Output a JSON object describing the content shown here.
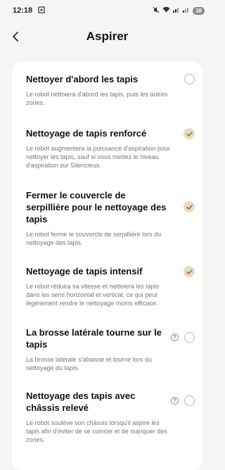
{
  "status_bar": {
    "time": "12:18",
    "battery": "38"
  },
  "header": {
    "title": "Aspirer"
  },
  "items": [
    {
      "title": "Nettoyer d'abord les tapis",
      "description": "Le robot nettoiera d'abord les tapis, puis les autres zones.",
      "enabled": false
    },
    {
      "title": "Nettoyage de tapis renforcé",
      "description": "Le robot augmentera la puissance d'aspiration pour nettoyer les tapis, sauf si vous mettez le niveau d'aspiration sur Silencieux.",
      "enabled": true
    },
    {
      "title": "Fermer le couvercle de serpillière pour le nettoyage des tapis",
      "description": "Le robot ferme le couvercle de serpillière lors du nettoyage des tapis.",
      "enabled": true
    },
    {
      "title": "Nettoyage de tapis intensif",
      "description": "Le robot réduira sa vitesse et nettoiera les tapis dans les sens horizontal et vertical, ce qui peut légèrement rendre le nettoyage moins efficace.",
      "enabled": true
    },
    {
      "title": "La brosse latérale tourne sur le tapis",
      "description": "La brosse latérale s'abaisse et tourne lors du nettoyage du tapis.",
      "enabled": false
    },
    {
      "title": "Nettoyage des tapis avec châssis relevé",
      "description": "Le robot soulève son châssis lorsqu'il aspire les tapis afin d'éviter de se coincer et de manquer des zones.",
      "enabled": false
    }
  ],
  "icons": {
    "back": "chevron-left-icon",
    "check": "check-icon",
    "help": "question-icon"
  },
  "colors": {
    "background": "#f5f5f5",
    "card": "#ffffff",
    "checked_fill": "#e8dcc0",
    "checked_mark": "#8a6a2c"
  }
}
